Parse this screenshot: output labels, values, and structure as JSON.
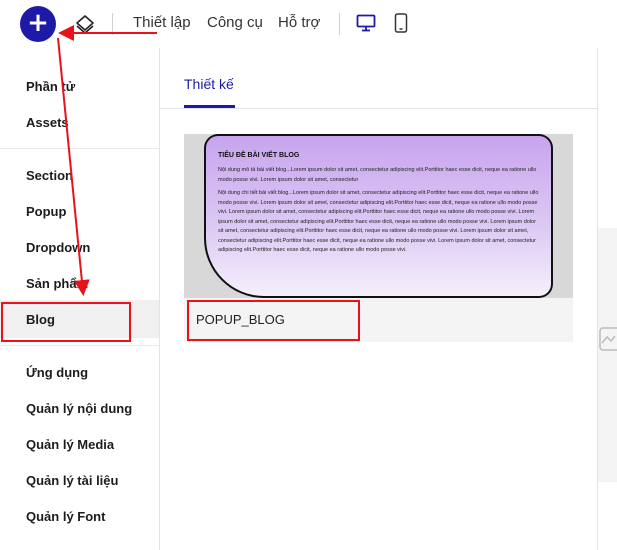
{
  "toolbar": {
    "add_icon": "plus-icon",
    "add_label": "+",
    "layers_icon": "layers-icon",
    "menu": [
      "Thiết lập",
      "Công cụ",
      "Hỗ trợ"
    ],
    "desktop_icon": "desktop-icon",
    "mobile_icon": "mobile-icon",
    "accent_color": "#1e1aa8"
  },
  "sidebar": {
    "items": [
      "Phần tử",
      "Assets",
      "Section",
      "Popup",
      "Dropdown",
      "Sản phẩm",
      "Blog",
      "Ứng dụng",
      "Quản lý nội dung",
      "Quản lý Media",
      "Quản lý tài liệu",
      "Quản lý Font"
    ],
    "active": "Blog"
  },
  "main": {
    "tab": "Thiết kế",
    "template": {
      "preview_title": "TIÊU ĐỀ BÀI VIẾT BLOG",
      "preview_desc": "Nội dung mô tả bài viết blog...Lorem ipsum dolor sit amet, consectetur adipiscing elit.Porttitor haec esse dicit, neque ea ratione ullo modo posse vivi. Lorem ipsum dolor sit amet, consectetur",
      "preview_detail": "Nội dung chi tiết bài viết blog...Lorem ipsum dolor sit amet, consectetur adipiscing elit.Porttitor haec esse dicit, neque ea ratione ullo modo posse vivi. Lorem ipsum dolor sit amet, consectetur adipiscing elit.Porttitor haec esse dicit, neque ea ratione ullo modo posse vivi. Lorem ipsum dolor sit amet, consectetur adipiscing elit.Porttitor haec esse dicit, neque ea ratione ullo modo posse vivi. Lorem ipsum dolor sit amet, consectetur adipiscing elit.Porttitor haec esse dicit, neque ea ratione ullo modo posse vivi. Lorem ipsum dolor sit amet, consectetur adipiscing elit.Porttitor haec esse dicit, neque ea ratione ullo modo posse vivi. Lorem ipsum dolor sit amet, consectetur adipiscing elit.Porttitor haec esse dicit, neque ea ratione ullo modo posse vivi. Lorem ipsum dolor sit amet, consectetur adipiscing elit.Porttitor haec esse dicit, neque ea ratione ullo modo posse vivi.",
      "name": "POPUP_BLOG"
    }
  },
  "annotation_color": "#e8121b"
}
